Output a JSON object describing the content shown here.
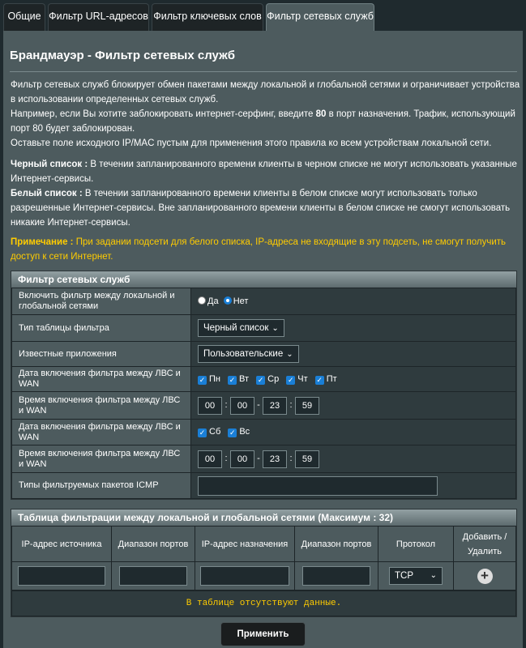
{
  "tabs": [
    {
      "label": "Общие"
    },
    {
      "label": "Фильтр URL-адресов"
    },
    {
      "label": "Фильтр ключевых слов"
    },
    {
      "label": "Фильтр сетевых служб"
    }
  ],
  "page": {
    "title": "Брандмауэр - Фильтр сетевых служб",
    "desc1": "Фильтр сетевых служб блокирует обмен пакетами между локальной и глобальной сетями и ограничивает устройства в использовании определенных сетевых служб.",
    "desc2a": "Например, если Вы хотите заблокировать интернет-серфинг, введите ",
    "desc2b": "80",
    "desc2c": " в порт назначения. Трафик, использующий порт 80 будет заблокирован.",
    "desc3": "Оставьте поле исходного IP/MAC пустым для применения этого правила ко всем устройствам локальной сети.",
    "black_label": "Черный список :",
    "black_text": " В течении запланированного времени клиенты в черном списке не могут использовать указанные Интернет-сервисы.",
    "white_label": "Белый список :",
    "white_text": " В течении запланированного времени клиенты в белом списке могут использовать только разрешенные Интернет-сервисы. Вне запланированного времени клиенты в белом списке не смогут использовать никакие Интернет-сервисы.",
    "note_label": "Примечание :",
    "note_text": " При задании подсети для белого списка, IP-адреса не входящие в эту подсеть, не смогут получить доступ к сети Интернет."
  },
  "filter": {
    "header": "Фильтр сетевых служб",
    "enable_label": "Включить фильтр между локальной и глобальной сетями",
    "yes": "Да",
    "no": "Нет",
    "table_type_label": "Тип таблицы фильтра",
    "table_type_value": "Черный список",
    "apps_label": "Известные приложения",
    "apps_value": "Пользовательские",
    "date1_label": "Дата включения фильтра между ЛВС и WAN",
    "days1": [
      "Пн",
      "Вт",
      "Ср",
      "Чт",
      "Пт"
    ],
    "time1_label": "Время включения фильтра между ЛВС и WAN",
    "time1": [
      "00",
      "00",
      "23",
      "59"
    ],
    "date2_label": "Дата включения фильтра между ЛВС и WAN",
    "days2": [
      "Сб",
      "Вс"
    ],
    "time2_label": "Время включения фильтра между ЛВС и WAN",
    "time2": [
      "00",
      "00",
      "23",
      "59"
    ],
    "icmp_label": "Типы фильтруемых пакетов ICMP"
  },
  "rules": {
    "header": "Таблица фильтрации между локальной и глобальной сетями (Максимум : 32)",
    "columns": [
      "IP-адрес источника",
      "Диапазон портов",
      "IP-адрес назначения",
      "Диапазон портов",
      "Протокол",
      "Добавить / Удалить"
    ],
    "protocol": "TCP",
    "empty": "В таблице отсутствуют данные."
  },
  "apply_label": "Применить"
}
